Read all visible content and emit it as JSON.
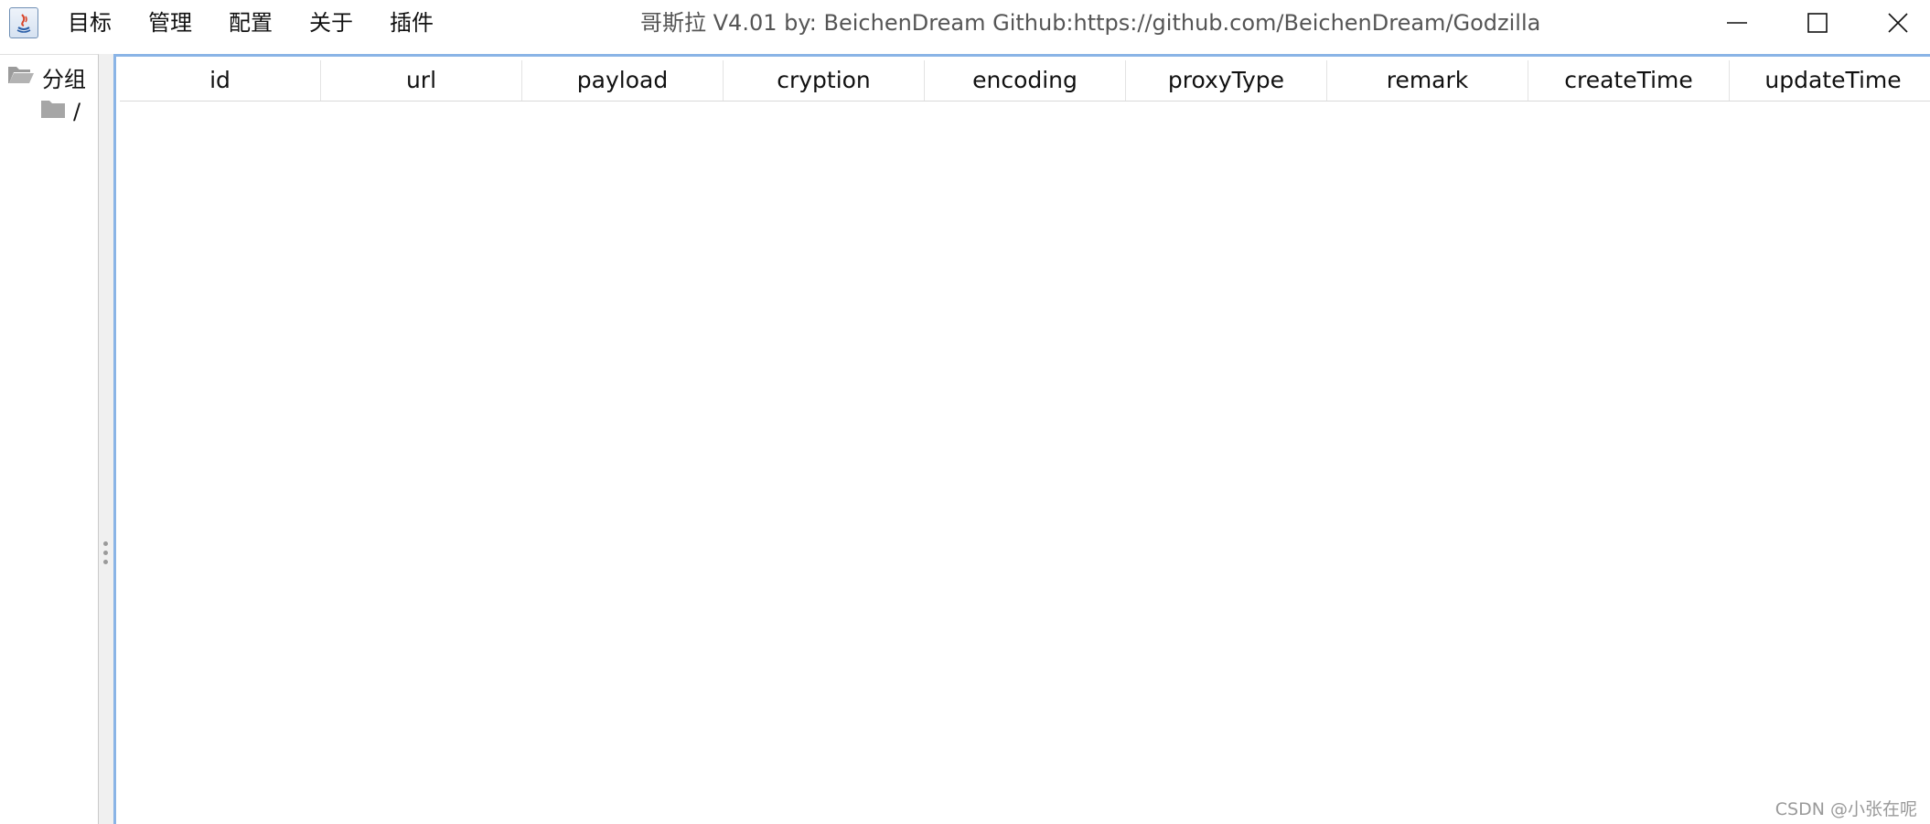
{
  "menu": {
    "items": [
      {
        "label": "目标"
      },
      {
        "label": "管理"
      },
      {
        "label": "配置"
      },
      {
        "label": "关于"
      },
      {
        "label": "插件"
      }
    ]
  },
  "window": {
    "title": "哥斯拉   V4.01 by: BeichenDream Github:https://github.com/BeichenDream/Godzilla",
    "controls": [
      "minimize-icon",
      "maximize-icon",
      "close-icon"
    ]
  },
  "tree": {
    "root": {
      "label": "分组",
      "icon": "folder-open-icon"
    },
    "children": [
      {
        "label": "/",
        "icon": "folder-icon"
      }
    ]
  },
  "table": {
    "columns": [
      "id",
      "url",
      "payload",
      "cryption",
      "encoding",
      "proxyType",
      "remark",
      "createTime",
      "updateTime"
    ],
    "rows": []
  },
  "watermark": "CSDN @小张在呢",
  "colors": {
    "selection_border": "#8ab4e6",
    "menu_text": "#111111",
    "title_text": "#555555"
  }
}
